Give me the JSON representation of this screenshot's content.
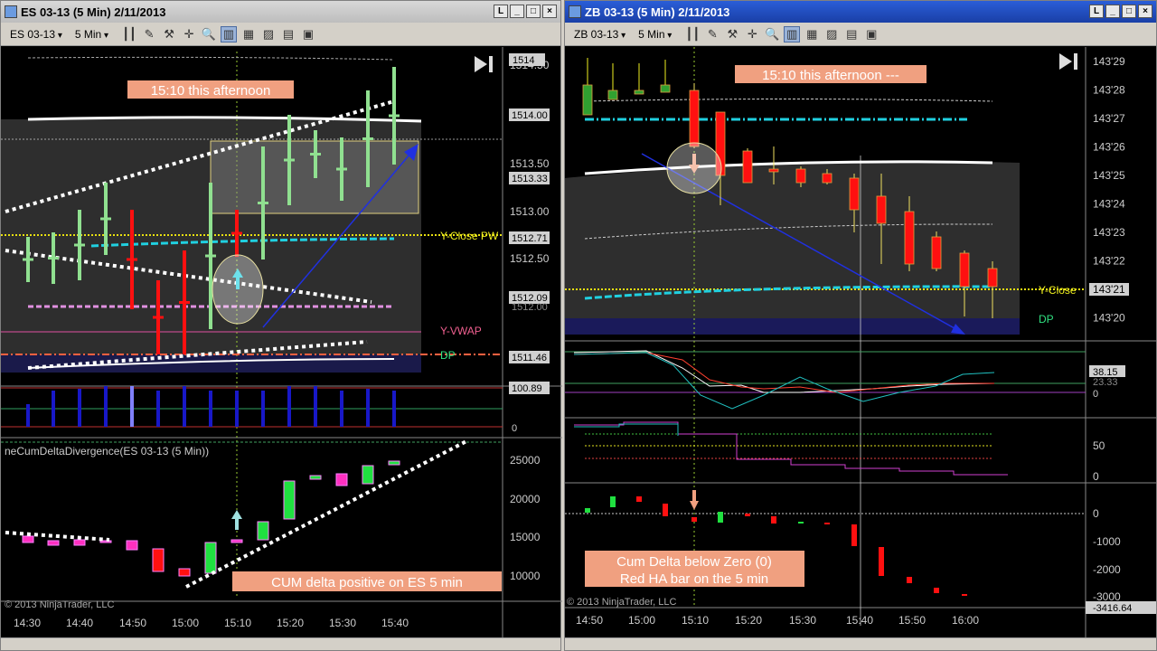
{
  "left": {
    "title": "ES 03-13 (5 Min)  2/11/2013",
    "instrument": "ES 03-13",
    "interval": "5 Min",
    "price_labels": [
      "1514.50",
      "1514.00",
      "1513.50",
      "1513.33",
      "1513.00",
      "1512.71",
      "1512.50",
      "1512.09",
      "1512.00",
      "1511.46"
    ],
    "price_tag_top": "1514",
    "annotation_top": "15:10 this afternoon",
    "annotation_bottom": "CUM delta positive on ES 5 min",
    "line_labels": {
      "yclose": "Y-Close  PW",
      "yvwap": "Y-VWAP",
      "dp": "DP"
    },
    "vol_labels": [
      "100.89",
      "0"
    ],
    "indicator_title": "neCumDeltaDivergence(ES 03-13 (5 Min))",
    "cum_labels": [
      "25000",
      "20000",
      "15000",
      "10000"
    ],
    "copyright": "© 2013 NinjaTrader, LLC",
    "time_labels": [
      "14:30",
      "14:40",
      "14:50",
      "15:00",
      "15:10",
      "15:20",
      "15:30",
      "15:40"
    ]
  },
  "right": {
    "title": "ZB 03-13 (5 Min)  2/11/2013",
    "instrument": "ZB 03-13",
    "interval": "5 Min",
    "price_labels": [
      "143'29",
      "143'28",
      "143'27",
      "143'26",
      "143'25",
      "143'24",
      "143'23",
      "143'22",
      "143'21",
      "143'20"
    ],
    "annotation_top": "15:10 this afternoon ---",
    "line_labels": {
      "yclose": "Y-Close",
      "dp": "DP"
    },
    "osc_labels": [
      "38.15",
      "23.33",
      "0"
    ],
    "pct_labels": [
      "50",
      "0"
    ],
    "cum_labels": [
      "0",
      "-1000",
      "-2000",
      "-3000",
      "-3416.64"
    ],
    "annotation_bottom_1": "Cum Delta below Zero (0)",
    "annotation_bottom_2": "Red HA bar on the 5 min",
    "copyright": "© 2013 NinjaTrader, LLC",
    "time_labels": [
      "14:50",
      "15:00",
      "15:10",
      "15:20",
      "15:30",
      "15:40",
      "15:50",
      "16:00"
    ]
  },
  "colors": {
    "up": "#90e090",
    "down": "#ff1010",
    "annotation": "#f0a080",
    "cyan": "#20d0e0",
    "yellow": "#f0f020",
    "vol": "#1818c8"
  }
}
